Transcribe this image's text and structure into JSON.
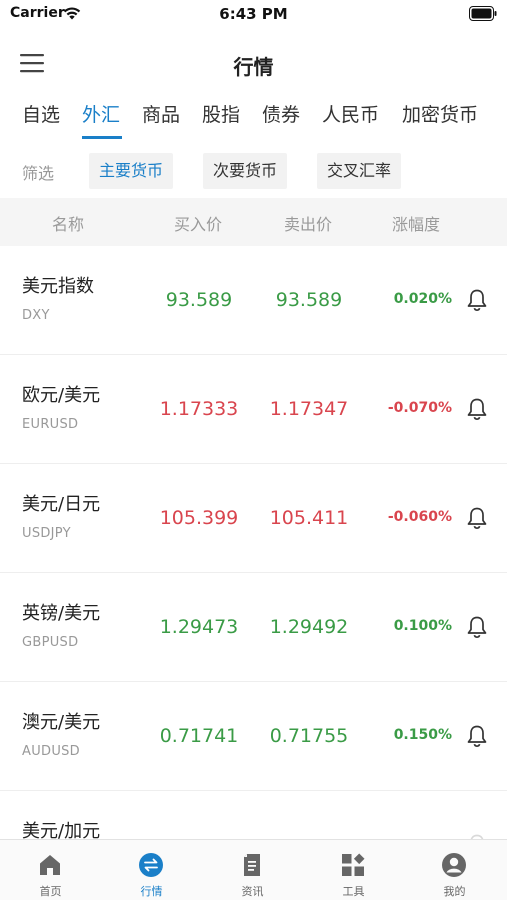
{
  "status_bar": {
    "carrier": "Carrier",
    "time": "6:43 PM"
  },
  "nav": {
    "title": "行情"
  },
  "category_tabs": [
    {
      "label": "自选",
      "active": false
    },
    {
      "label": "外汇",
      "active": true
    },
    {
      "label": "商品",
      "active": false
    },
    {
      "label": "股指",
      "active": false
    },
    {
      "label": "债券",
      "active": false
    },
    {
      "label": "人民币",
      "active": false
    },
    {
      "label": "加密货币",
      "active": false
    }
  ],
  "filter": {
    "label": "筛选",
    "chips": [
      {
        "label": "主要货币",
        "active": true
      },
      {
        "label": "次要货币",
        "active": false
      },
      {
        "label": "交叉汇率",
        "active": false
      }
    ]
  },
  "table": {
    "headers": {
      "name": "名称",
      "buy": "买入价",
      "sell": "卖出价",
      "change": "涨幅度"
    },
    "rows": [
      {
        "name": "美元指数",
        "code": "DXY",
        "buy": "93.589",
        "sell": "93.589",
        "change": "0.020%",
        "direction": "up"
      },
      {
        "name": "欧元/美元",
        "code": "EURUSD",
        "buy": "1.17333",
        "sell": "1.17347",
        "change": "-0.070%",
        "direction": "down"
      },
      {
        "name": "美元/日元",
        "code": "USDJPY",
        "buy": "105.399",
        "sell": "105.411",
        "change": "-0.060%",
        "direction": "down"
      },
      {
        "name": "英镑/美元",
        "code": "GBPUSD",
        "buy": "1.29473",
        "sell": "1.29492",
        "change": "0.100%",
        "direction": "up"
      },
      {
        "name": "澳元/美元",
        "code": "AUDUSD",
        "buy": "0.71741",
        "sell": "0.71755",
        "change": "0.150%",
        "direction": "up"
      },
      {
        "name": "美元/加元",
        "code": "",
        "buy": "",
        "sell": "",
        "change": "",
        "direction": "up"
      }
    ]
  },
  "tab_bar": [
    {
      "label": "首页",
      "icon": "home-icon",
      "active": false
    },
    {
      "label": "行情",
      "icon": "exchange-icon",
      "active": true
    },
    {
      "label": "资讯",
      "icon": "news-icon",
      "active": false
    },
    {
      "label": "工具",
      "icon": "tools-icon",
      "active": false
    },
    {
      "label": "我的",
      "icon": "profile-icon",
      "active": false
    }
  ],
  "colors": {
    "accent": "#1a7fc8",
    "up": "#3a9b46",
    "down": "#d9454e"
  }
}
